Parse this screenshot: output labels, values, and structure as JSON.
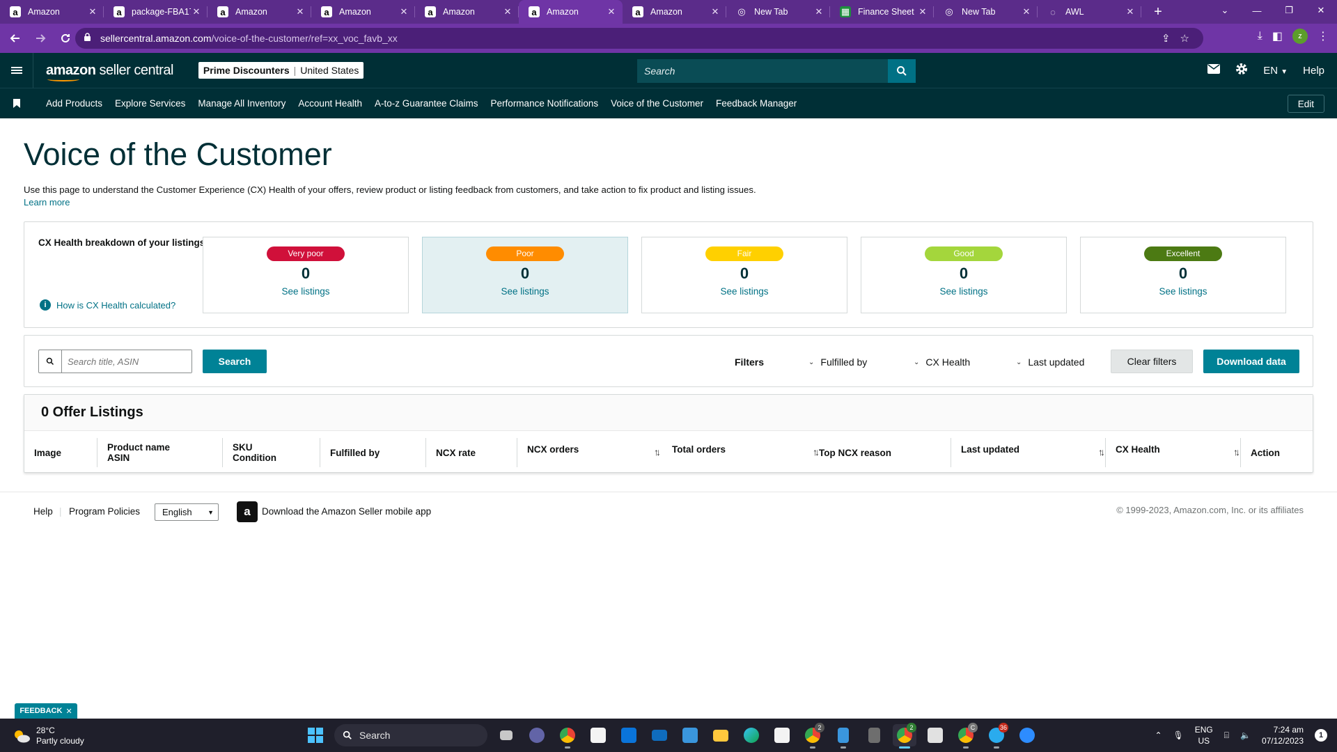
{
  "browser": {
    "tabs": [
      {
        "title": "Amazon",
        "favicon": "amazon-icon",
        "active": false
      },
      {
        "title": "package-FBA17",
        "favicon": "amazon-icon",
        "active": false
      },
      {
        "title": "Amazon",
        "favicon": "amazon-icon",
        "active": false
      },
      {
        "title": "Amazon",
        "favicon": "amazon-icon",
        "active": false
      },
      {
        "title": "Amazon",
        "favicon": "amazon-icon",
        "active": false
      },
      {
        "title": "Amazon",
        "favicon": "amazon-icon",
        "active": true
      },
      {
        "title": "Amazon",
        "favicon": "amazon-icon",
        "active": false
      },
      {
        "title": "New Tab",
        "favicon": "chrome-icon",
        "active": false
      },
      {
        "title": "Finance Sheet",
        "favicon": "sheets-icon",
        "active": false
      },
      {
        "title": "New Tab",
        "favicon": "chrome-icon",
        "active": false
      },
      {
        "title": "AWL",
        "favicon": "globe-icon",
        "active": false
      }
    ],
    "url_domain": "sellercentral.amazon.com",
    "url_path": "/voice-of-the-customer/ref=xx_voc_favb_xx",
    "profile_initial": "z",
    "colors": {
      "frame": "#5b2c8a",
      "toolbar": "#6f35a6"
    }
  },
  "header": {
    "logo_bold": "amazon",
    "logo_light": " seller central",
    "store_name": "Prime Discounters",
    "store_region": "United States",
    "search_placeholder": "Search",
    "language": "EN",
    "help": "Help",
    "colors": {
      "background": "#002f36",
      "accent": "#008296"
    }
  },
  "bookmarks": {
    "items": [
      "Add Products",
      "Explore Services",
      "Manage All Inventory",
      "Account Health",
      "A-to-z Guarantee Claims",
      "Performance Notifications",
      "Voice of the Customer",
      "Feedback Manager"
    ],
    "edit": "Edit"
  },
  "page": {
    "title": "Voice of the Customer",
    "description": "Use this page to understand the Customer Experience (CX) Health of your offers, review product or listing feedback from customers, and take action to fix product and listing issues.",
    "learn_more": "Learn more"
  },
  "cx_health": {
    "heading": "CX Health breakdown of your listings",
    "help_link": "How is CX Health calculated?",
    "cards": [
      {
        "label": "Very poor",
        "count": "0",
        "link": "See listings",
        "color": "#d0103a",
        "text_color": "#ffffff"
      },
      {
        "label": "Poor",
        "count": "0",
        "link": "See listings",
        "color": "#ff8c00",
        "text_color": "#ffffff"
      },
      {
        "label": "Fair",
        "count": "0",
        "link": "See listings",
        "color": "#ffd000",
        "text_color": "#ffffff"
      },
      {
        "label": "Good",
        "count": "0",
        "link": "See listings",
        "color": "#a4d63c",
        "text_color": "#ffffff"
      },
      {
        "label": "Excellent",
        "count": "0",
        "link": "See listings",
        "color": "#4c7a13",
        "text_color": "#ffffff"
      }
    ],
    "selected_card": "Poor"
  },
  "filters": {
    "search_placeholder": "Search title, ASIN",
    "search_button": "Search",
    "filters_label": "Filters",
    "fulfilled_by": "Fulfilled by",
    "cx_health": "CX Health",
    "last_updated": "Last updated",
    "clear_button": "Clear filters",
    "download_button": "Download data"
  },
  "listings": {
    "heading": "0 Offer Listings",
    "columns": {
      "image": "Image",
      "product_name": "Product name",
      "asin": "ASIN",
      "sku": "SKU",
      "condition": "Condition",
      "fulfilled_by": "Fulfilled by",
      "ncx_rate": "NCX rate",
      "ncx_orders": "NCX orders",
      "total_orders": "Total orders",
      "top_ncx_reason": "Top NCX reason",
      "last_updated": "Last updated",
      "cx_health": "CX Health",
      "action": "Action"
    }
  },
  "footer": {
    "help": "Help",
    "program_policies": "Program Policies",
    "language": "English",
    "app_text": "Download the Amazon Seller mobile app",
    "copyright": "© 1999-2023, Amazon.com, Inc. or its affiliates"
  },
  "feedback": "FEEDBACK",
  "taskbar": {
    "temperature": "28°C",
    "weather": "Partly cloudy",
    "search": "Search",
    "language_line1": "ENG",
    "language_line2": "US",
    "time": "7:24 am",
    "date": "07/12/2023",
    "notifications": "1",
    "badges": {
      "chrome_1": "2",
      "chrome_2": "2",
      "chrome_3": "C",
      "telegram": "36"
    }
  }
}
